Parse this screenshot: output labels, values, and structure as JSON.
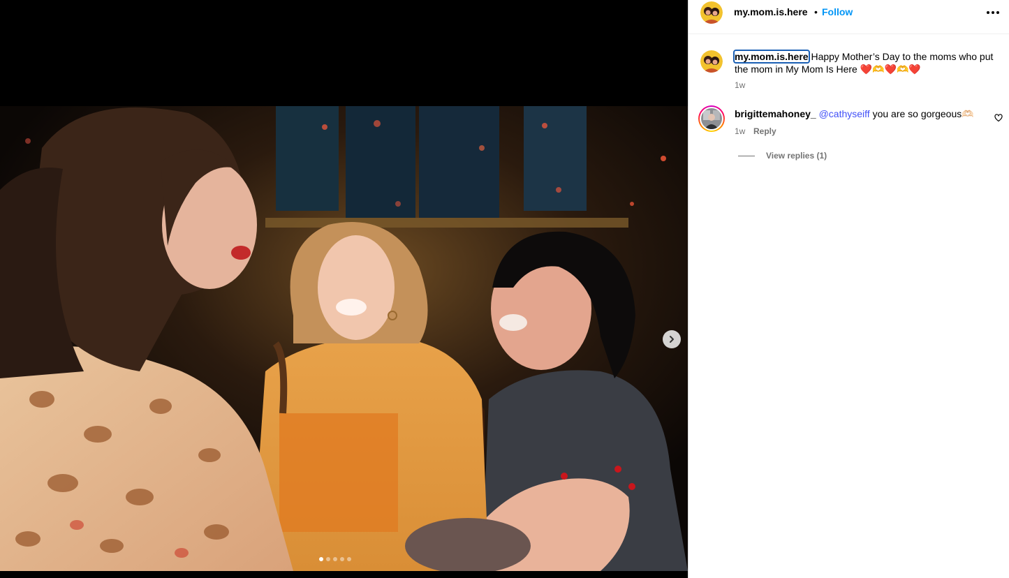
{
  "post": {
    "author": "my.mom.is.here",
    "separator": "•",
    "follow_label": "Follow",
    "more_icon": "more-horizontal-icon"
  },
  "media": {
    "next_icon": "chevron-right-icon",
    "carousel_count": 5,
    "carousel_active_index": 0
  },
  "caption": {
    "author": "my.mom.is.here",
    "text": "Happy Mother’s Day to the moms who put the mom in My Mom Is Here ❤️🫶❤️🫶❤️",
    "time": "1w"
  },
  "comments": [
    {
      "author": "brigittemahoney_",
      "mention": "@cathyseiff",
      "text": " you are so gorgeous🫶🏻",
      "time": "1w",
      "reply_label": "Reply",
      "view_replies_label": "View replies (1)",
      "like_icon": "heart-outline-icon"
    }
  ],
  "colors": {
    "link_blue": "#0095f6",
    "mention_blue": "#4150f7",
    "muted_text": "#737373",
    "media_background": "#000000"
  }
}
